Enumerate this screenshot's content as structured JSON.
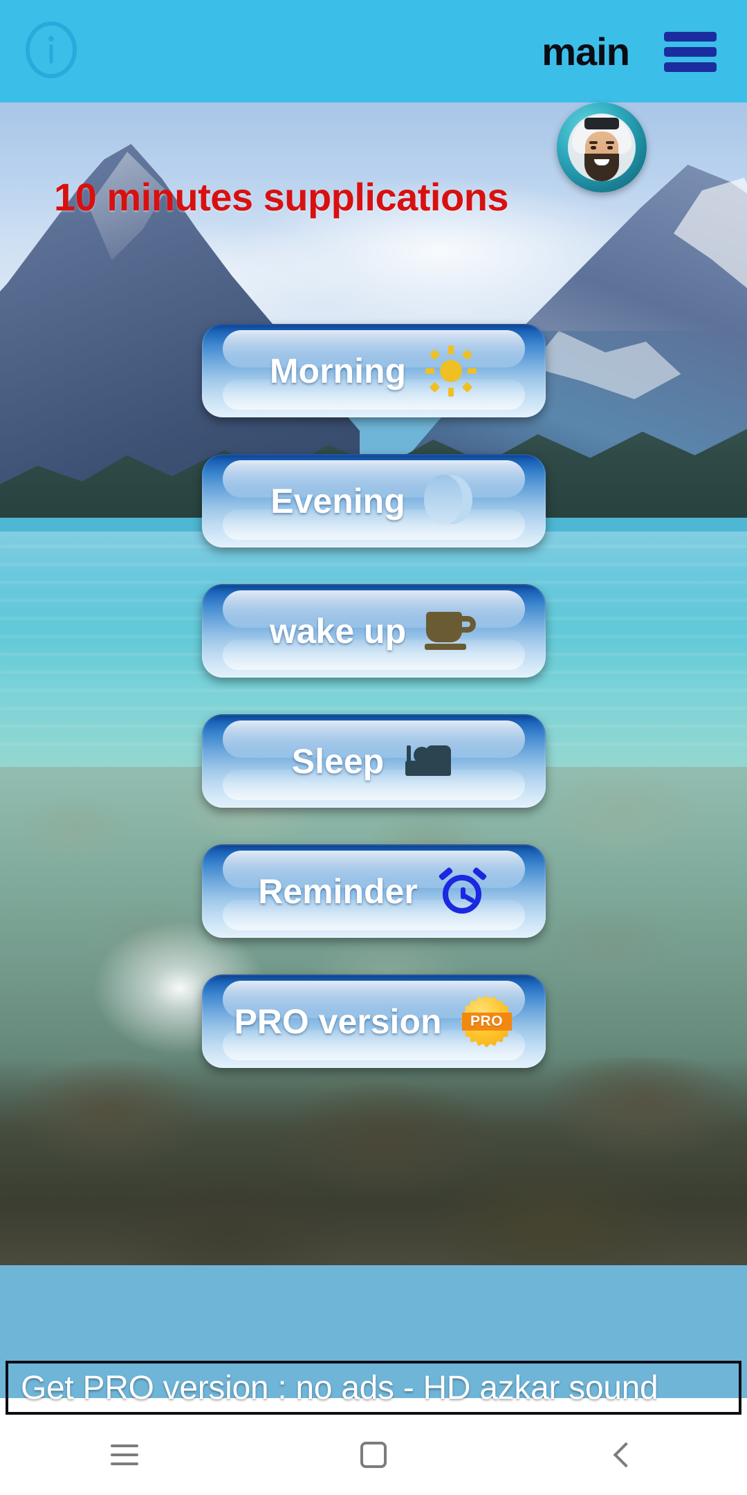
{
  "app_bar": {
    "title": "main",
    "info_icon": "info-circle-icon",
    "menu_icon": "hamburger-menu-icon",
    "background_color": "#3bbfe8",
    "menu_color": "#1b2d9e"
  },
  "header": {
    "headline": "10 minutes supplications",
    "headline_color": "#d81010",
    "avatar": "reciter-avatar"
  },
  "buttons": [
    {
      "label": "Morning",
      "icon": "sun-icon",
      "icon_color": "#eec024"
    },
    {
      "label": "Evening",
      "icon": "crescent-moon-icon",
      "icon_color": "#181e2b"
    },
    {
      "label": "wake up",
      "icon": "coffee-cup-icon",
      "icon_color": "#6b5b33"
    },
    {
      "label": "Sleep",
      "icon": "bed-icon",
      "icon_color": "#2a4450"
    },
    {
      "label": "Reminder",
      "icon": "alarm-clock-icon",
      "icon_color": "#1a28e0"
    },
    {
      "label": "PRO version",
      "icon": "pro-badge-icon",
      "icon_color": "#f2880f",
      "badge_text": "PRO"
    }
  ],
  "ad_banner": {
    "text": "Get PRO version : no ads - HD azkar sound",
    "background_color": "#1d72bd"
  },
  "system_nav": {
    "recents": "recents-icon",
    "home": "home-icon",
    "back": "back-icon"
  }
}
